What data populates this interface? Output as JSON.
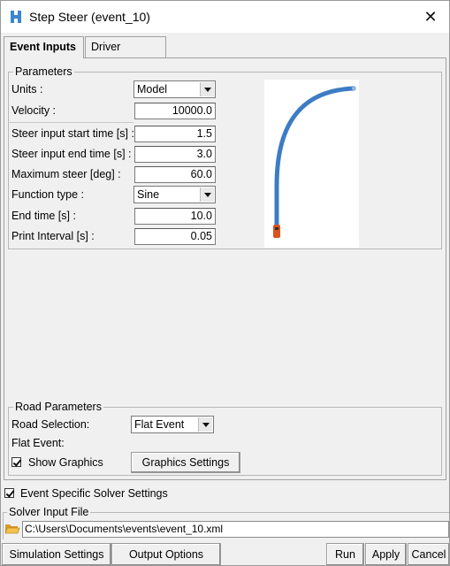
{
  "window": {
    "title": "Step Steer (event_10)",
    "close_glyph": "✕"
  },
  "tabs": [
    {
      "label": "Event Inputs",
      "active": true
    },
    {
      "label": "Driver",
      "active": false
    }
  ],
  "parameters": {
    "legend": "Parameters",
    "units_label": "Units :",
    "units_value": "Model",
    "velocity_label": "Velocity :",
    "velocity_value": "10000.0",
    "steer_start_label": "Steer input start time [s] :",
    "steer_start_value": "1.5",
    "steer_end_label": "Steer input end time [s] :",
    "steer_end_value": "3.0",
    "max_steer_label": "Maximum steer [deg] :",
    "max_steer_value": "60.0",
    "function_type_label": "Function type :",
    "function_type_value": "Sine",
    "end_time_label": "End time [s] :",
    "end_time_value": "10.0",
    "print_interval_label": "Print Interval [s] :",
    "print_interval_value": "0.05"
  },
  "road": {
    "legend": "Road Parameters",
    "selection_label": "Road Selection:",
    "selection_value": "Flat Event",
    "flat_event_label": "Flat Event:",
    "show_graphics_label": "Show Graphics",
    "show_graphics_checked": true,
    "graphics_settings_label": "Graphics Settings"
  },
  "solver": {
    "event_specific_label": "Event Specific Solver Settings",
    "event_specific_checked": true,
    "input_file_legend": "Solver Input File",
    "input_file_path": "C:\\Users\\Documents\\events\\event_10.xml"
  },
  "footer": {
    "simulation_settings": "Simulation Settings",
    "output_options": "Output Options",
    "run": "Run",
    "apply": "Apply",
    "cancel": "Cancel"
  },
  "icons": {
    "app": "app-logo-icon",
    "folder": "folder-open-icon",
    "close": "close-icon"
  },
  "colors": {
    "path_line": "#3d7cc4",
    "vehicle": "#d9531e"
  }
}
